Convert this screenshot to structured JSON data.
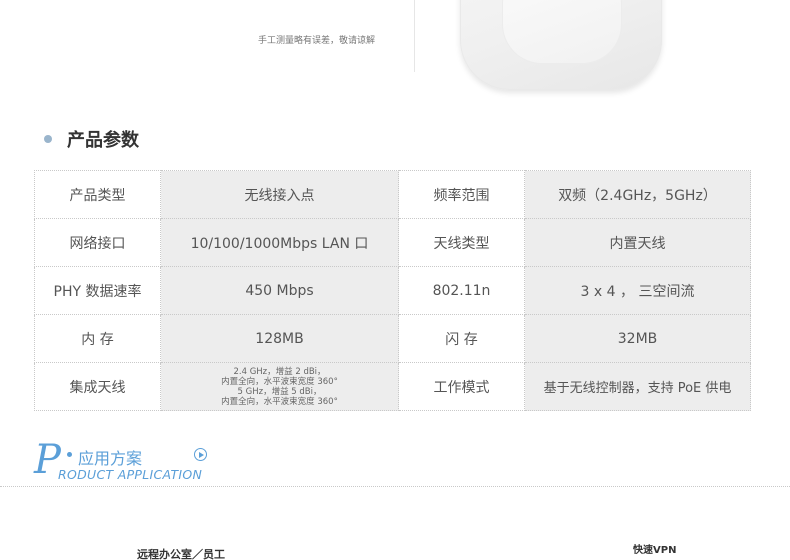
{
  "note": "手工测量略有误差，敬请谅解",
  "section_title": "产品参数",
  "specs": [
    [
      "产品类型",
      "无线接入点",
      "频率范围",
      "双频（2.4GHz，5GHz）"
    ],
    [
      "网络接口",
      "10/100/1000Mbps LAN 口",
      "天线类型",
      "内置天线"
    ],
    [
      "PHY 数据速率",
      "450 Mbps",
      "802.11n",
      "3 x 4 ， 三空间流"
    ],
    [
      "内 存",
      "128MB",
      "闪 存",
      "32MB"
    ],
    [
      "集成天线",
      [
        "2.4 GHz，增益 2 dBi，",
        "内置全向，水平波束宽度 360°",
        "5 GHz，增益 5 dBi，",
        "内置全向，水平波束宽度 360°"
      ],
      "工作模式",
      "基于无线控制器，支持 PoE 供电"
    ]
  ],
  "application": {
    "letter": "P",
    "title_cn": "应用方案",
    "title_en": "RODUCT  APPLICATION"
  },
  "scenes": {
    "remote_office": "远程办公室／员工",
    "fast_vpn": "快速VPN"
  },
  "colors": {
    "accent": "#5b9fd8",
    "bullet": "#9ab5cc",
    "value_cell_bg": "#ededed"
  },
  "icons": {
    "section_bullet": "dot",
    "application_arrow": "play-circle"
  }
}
